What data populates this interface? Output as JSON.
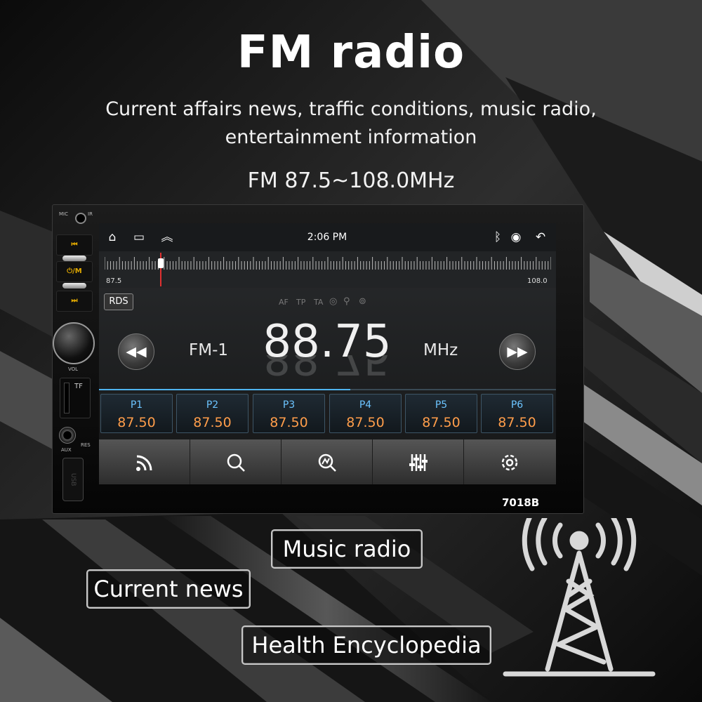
{
  "promo": {
    "title": "FM radio",
    "subtitle_line1": "Current affairs news, traffic conditions, music radio,",
    "subtitle_line2": "entertainment information",
    "band_range": "FM 87.5~108.0MHz"
  },
  "device": {
    "model": "7018B",
    "labels": {
      "mic": "MIC",
      "ir": "IR",
      "tf": "TF",
      "aux": "AUX",
      "res": "RES",
      "vol": "VOL",
      "usb": "USB"
    },
    "buttons": {
      "prev": "⏮",
      "power_mode": "⏻/M",
      "next": "⏭"
    }
  },
  "screen": {
    "status": {
      "time": "2:06 PM",
      "icons": [
        "home-icon",
        "recent-apps-icon",
        "expand-icon",
        "bluetooth-icon",
        "radio-signal-icon",
        "back-icon"
      ]
    },
    "scale": {
      "min_label": "87.5",
      "max_label": "108.0",
      "current_mhz": 88.75,
      "min_mhz": 87.5,
      "max_mhz": 108.0
    },
    "rds_label": "RDS",
    "flags": [
      "AF",
      "TP",
      "TA"
    ],
    "band": "FM-1",
    "frequency": "88.75",
    "unit": "MHz",
    "presets": [
      {
        "name": "P1",
        "freq": "87.50"
      },
      {
        "name": "P2",
        "freq": "87.50"
      },
      {
        "name": "P3",
        "freq": "87.50"
      },
      {
        "name": "P4",
        "freq": "87.50"
      },
      {
        "name": "P5",
        "freq": "87.50"
      },
      {
        "name": "P6",
        "freq": "87.50"
      }
    ],
    "toolbar": [
      "radio-waves-icon",
      "search-icon",
      "scan-icon",
      "equalizer-icon",
      "settings-icon"
    ]
  },
  "tags": {
    "music": "Music radio",
    "news": "Current news",
    "health": "Health Encyclopedia"
  },
  "colors": {
    "preset_name": "#6cc4ff",
    "preset_freq": "#ff9d4a",
    "tuner_needle": "#e03030",
    "side_buttons": "#e0a800"
  }
}
